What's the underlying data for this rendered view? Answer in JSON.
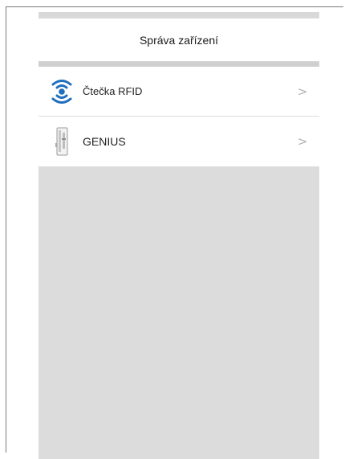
{
  "header": {
    "title": "Správa zařízení"
  },
  "devices": [
    {
      "label": "Čtečka RFID",
      "icon": "rfid-reader-icon",
      "chevron": ">"
    },
    {
      "label": "GENIUS",
      "icon": "genius-device-icon",
      "chevron": ">"
    }
  ],
  "colors": {
    "accent_blue": "#1f6fbf",
    "background_gray": "#dcdcdc",
    "chevron_gray": "#b0b0b0"
  }
}
